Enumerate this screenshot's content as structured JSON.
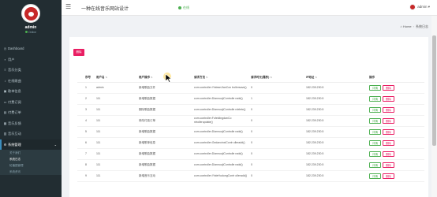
{
  "sidebar": {
    "username": "admin",
    "status": "Online",
    "menu": [
      {
        "label": "Dashboard",
        "icon": "dashboard-icon"
      },
      {
        "label": "用户",
        "icon": "users-icon"
      },
      {
        "label": "音乐分类",
        "icon": "list-icon"
      },
      {
        "label": "在线歌曲",
        "icon": "music-icon"
      },
      {
        "label": "歌单信息",
        "icon": "folder-icon"
      },
      {
        "label": "付费订阅",
        "icon": "card-icon"
      },
      {
        "label": "付费订单",
        "icon": "cart-icon"
      },
      {
        "label": "音乐反馈",
        "icon": "comment-icon"
      },
      {
        "label": "音乐互动",
        "icon": "chat-icon"
      },
      {
        "label": "系统管理",
        "icon": "gear-icon",
        "active": true
      }
    ],
    "submenu": [
      "关于我们",
      "系统日志",
      "轮播图管理",
      "系统资讯"
    ]
  },
  "header": {
    "title": "一种在线音乐网站设计",
    "status": "在线",
    "user": "admin"
  },
  "breadcrumb": {
    "home": "Home",
    "current": "系统日志"
  },
  "toolbar": {
    "delete_label": "删除"
  },
  "table": {
    "columns": [
      "序号",
      "用户名",
      "用户操作",
      "请求方法",
      "请求时长(毫秒)",
      "IP地址",
      "操作"
    ],
    "rows": [
      {
        "no": "1",
        "user": "admin",
        "op": "新增歌曲文件",
        "method": "com.controller.YinleanJianCon trollersave()",
        "ms": "0",
        "ip": "182.239.230.5"
      },
      {
        "no": "2",
        "user": "111",
        "op": "新增歌曲数据",
        "method": "com.controller.DiannuojiControlle radd()",
        "ms": "1",
        "ip": "182.239.230.5"
      },
      {
        "no": "3",
        "user": "111",
        "op": "删除歌曲数据",
        "method": "com.controller.DiannuojiControlle rdelete()",
        "ms": "0",
        "ip": "182.239.230.5"
      },
      {
        "no": "4",
        "user": "111",
        "op": "修改付费订单",
        "method": "com.controller.FufeidingdanCo ntrollerupdate()",
        "ms": "0",
        "ip": "182.239.230.5"
      },
      {
        "no": "5",
        "user": "111",
        "op": "新增歌曲数据",
        "method": "com.controller.DiannuojiControlle radd()",
        "ms": "0",
        "ip": "182.239.230.5"
      },
      {
        "no": "6",
        "user": "111",
        "op": "新增歌单信息",
        "method": "com.controller.GedanxinxiContr olleradd()",
        "ms": "0",
        "ip": "182.239.230.5"
      },
      {
        "no": "7",
        "user": "111",
        "op": "新增歌曲数据",
        "method": "com.controller.DiannuojiControlle radd()",
        "ms": "0",
        "ip": "182.239.230.5"
      },
      {
        "no": "8",
        "user": "111",
        "op": "新增歌曲数据",
        "method": "com.controller.DiannuojiControlle radd()",
        "ms": "0",
        "ip": "182.239.230.5"
      },
      {
        "no": "9",
        "user": "111",
        "op": "新增音乐互动",
        "method": "com.controller.YinleHudongContr olleradd()",
        "ms": "0",
        "ip": "182.239.230.5"
      }
    ],
    "detail_label": "详情",
    "delete_label": "删除"
  }
}
